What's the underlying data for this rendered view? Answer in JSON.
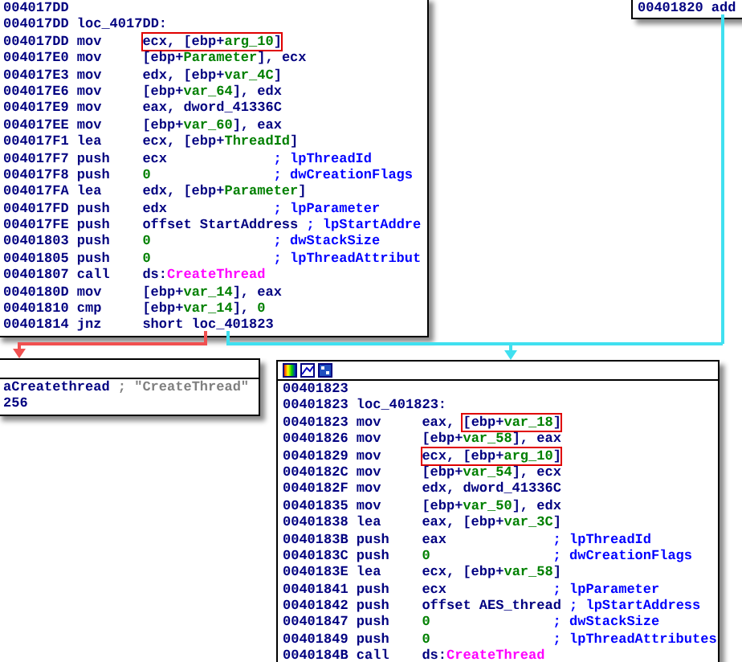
{
  "nodes": [
    {
      "kind": "plain",
      "lines": [
        {
          "address": "004017DD"
        },
        {
          "address": "004017DD",
          "label": "loc_4017DD:"
        },
        {
          "address": "004017DD",
          "mnemonic": "mov",
          "operands": [
            {
              "text": "ecx, [ebp+",
              "kind": "plain",
              "boxed": true
            },
            {
              "text": "arg_10",
              "kind": "var",
              "boxed": true
            },
            {
              "text": "]",
              "kind": "plain",
              "boxed": true
            }
          ]
        },
        {
          "address": "004017E0",
          "mnemonic": "mov",
          "operands": [
            {
              "text": "[ebp+",
              "kind": "plain",
              "boxed": false
            },
            {
              "text": "Parameter",
              "kind": "var",
              "boxed": false
            },
            {
              "text": "], ecx",
              "kind": "plain",
              "boxed": false
            }
          ]
        },
        {
          "address": "004017E3",
          "mnemonic": "mov",
          "operands": [
            {
              "text": "edx, [ebp+",
              "kind": "plain",
              "boxed": false
            },
            {
              "text": "var_4C",
              "kind": "var",
              "boxed": false
            },
            {
              "text": "]",
              "kind": "plain",
              "boxed": false
            }
          ]
        },
        {
          "address": "004017E6",
          "mnemonic": "mov",
          "operands": [
            {
              "text": "[ebp+",
              "kind": "plain",
              "boxed": false
            },
            {
              "text": "var_64",
              "kind": "var",
              "boxed": false
            },
            {
              "text": "], edx",
              "kind": "plain",
              "boxed": false
            }
          ]
        },
        {
          "address": "004017E9",
          "mnemonic": "mov",
          "operands": [
            {
              "text": "eax, dword_41336C",
              "kind": "plain",
              "boxed": false
            }
          ]
        },
        {
          "address": "004017EE",
          "mnemonic": "mov",
          "operands": [
            {
              "text": "[ebp+",
              "kind": "plain",
              "boxed": false
            },
            {
              "text": "var_60",
              "kind": "var",
              "boxed": false
            },
            {
              "text": "], eax",
              "kind": "plain",
              "boxed": false
            }
          ]
        },
        {
          "address": "004017F1",
          "mnemonic": "lea",
          "operands": [
            {
              "text": "ecx, [ebp+",
              "kind": "plain",
              "boxed": false
            },
            {
              "text": "ThreadId",
              "kind": "var",
              "boxed": false
            },
            {
              "text": "]",
              "kind": "plain",
              "boxed": false
            }
          ]
        },
        {
          "address": "004017F7",
          "mnemonic": "push",
          "operands": [
            {
              "text": "ecx",
              "kind": "plain",
              "boxed": false
            }
          ],
          "comment": {
            "text": "; lpThreadId",
            "kind": "param"
          }
        },
        {
          "address": "004017F8",
          "mnemonic": "push",
          "operands": [
            {
              "text": "0",
              "kind": "num",
              "boxed": false
            }
          ],
          "comment": {
            "text": "; dwCreationFlags",
            "kind": "param"
          }
        },
        {
          "address": "004017FA",
          "mnemonic": "lea",
          "operands": [
            {
              "text": "edx, [ebp+",
              "kind": "plain",
              "boxed": false
            },
            {
              "text": "Parameter",
              "kind": "var",
              "boxed": false
            },
            {
              "text": "]",
              "kind": "plain",
              "boxed": false
            }
          ]
        },
        {
          "address": "004017FD",
          "mnemonic": "push",
          "operands": [
            {
              "text": "edx",
              "kind": "plain",
              "boxed": false
            }
          ],
          "comment": {
            "text": "; lpParameter",
            "kind": "param"
          }
        },
        {
          "address": "004017FE",
          "mnemonic": "push",
          "operands": [
            {
              "text": "offset StartAddress",
              "kind": "plain",
              "boxed": false
            }
          ],
          "comment": {
            "text": "; lpStartAddre",
            "kind": "param"
          }
        },
        {
          "address": "00401803",
          "mnemonic": "push",
          "operands": [
            {
              "text": "0",
              "kind": "num",
              "boxed": false
            }
          ],
          "comment": {
            "text": "; dwStackSize",
            "kind": "param"
          }
        },
        {
          "address": "00401805",
          "mnemonic": "push",
          "operands": [
            {
              "text": "0",
              "kind": "num",
              "boxed": false
            }
          ],
          "comment": {
            "text": "; lpThreadAttribut",
            "kind": "param"
          }
        },
        {
          "address": "00401807",
          "mnemonic": "call",
          "operands": [
            {
              "text": "ds:",
              "kind": "plain",
              "boxed": false
            },
            {
              "text": "CreateThread",
              "kind": "import",
              "boxed": false
            }
          ]
        },
        {
          "address": "0040180D",
          "mnemonic": "mov",
          "operands": [
            {
              "text": "[ebp+",
              "kind": "plain",
              "boxed": false
            },
            {
              "text": "var_14",
              "kind": "var",
              "boxed": false
            },
            {
              "text": "], eax",
              "kind": "plain",
              "boxed": false
            }
          ]
        },
        {
          "address": "00401810",
          "mnemonic": "cmp",
          "operands": [
            {
              "text": "[ebp+",
              "kind": "plain",
              "boxed": false
            },
            {
              "text": "var_14",
              "kind": "var",
              "boxed": false
            },
            {
              "text": "], ",
              "kind": "plain",
              "boxed": false
            },
            {
              "text": "0",
              "kind": "num",
              "boxed": false
            }
          ]
        },
        {
          "address": "00401814",
          "mnemonic": "jnz",
          "operands": [
            {
              "text": "short loc_401823",
              "kind": "plain",
              "boxed": false
            }
          ]
        }
      ]
    },
    {
      "kind": "plain",
      "lines": [
        {
          "address": "00401820",
          "mnemonic": "add"
        }
      ]
    },
    {
      "kind": "titled",
      "lines": [
        {
          "operands": [
            {
              "text": "aCreatethread",
              "kind": "plain",
              "boxed": false
            }
          ],
          "comment": {
            "text": "; \"CreateThread\"",
            "kind": "string"
          }
        },
        {
          "operands": [
            {
              "text": "256",
              "kind": "plain",
              "boxed": false
            }
          ]
        }
      ]
    },
    {
      "kind": "toolbar",
      "lines": [
        {
          "address": "00401823"
        },
        {
          "address": "00401823",
          "label": "loc_401823:"
        },
        {
          "address": "00401823",
          "mnemonic": "mov",
          "operands": [
            {
              "text": "eax, ",
              "kind": "plain",
              "boxed": false
            },
            {
              "text": "[ebp+",
              "kind": "plain",
              "boxed": true
            },
            {
              "text": "var_18",
              "kind": "var",
              "boxed": true
            },
            {
              "text": "]",
              "kind": "plain",
              "boxed": true
            }
          ]
        },
        {
          "address": "00401826",
          "mnemonic": "mov",
          "operands": [
            {
              "text": "[ebp+",
              "kind": "plain",
              "boxed": false
            },
            {
              "text": "var_58",
              "kind": "var",
              "boxed": false
            },
            {
              "text": "], eax",
              "kind": "plain",
              "boxed": false
            }
          ]
        },
        {
          "address": "00401829",
          "mnemonic": "mov",
          "operands": [
            {
              "text": "ecx, [ebp+",
              "kind": "plain",
              "boxed": true
            },
            {
              "text": "arg_10",
              "kind": "var",
              "boxed": true
            },
            {
              "text": "]",
              "kind": "plain",
              "boxed": true
            }
          ]
        },
        {
          "address": "0040182C",
          "mnemonic": "mov",
          "operands": [
            {
              "text": "[ebp+",
              "kind": "plain",
              "boxed": false
            },
            {
              "text": "var_54",
              "kind": "var",
              "boxed": false
            },
            {
              "text": "], ecx",
              "kind": "plain",
              "boxed": false
            }
          ]
        },
        {
          "address": "0040182F",
          "mnemonic": "mov",
          "operands": [
            {
              "text": "edx, dword_41336C",
              "kind": "plain",
              "boxed": false
            }
          ]
        },
        {
          "address": "00401835",
          "mnemonic": "mov",
          "operands": [
            {
              "text": "[ebp+",
              "kind": "plain",
              "boxed": false
            },
            {
              "text": "var_50",
              "kind": "var",
              "boxed": false
            },
            {
              "text": "], edx",
              "kind": "plain",
              "boxed": false
            }
          ]
        },
        {
          "address": "00401838",
          "mnemonic": "lea",
          "operands": [
            {
              "text": "eax, [ebp+",
              "kind": "plain",
              "boxed": false
            },
            {
              "text": "var_3C",
              "kind": "var",
              "boxed": false
            },
            {
              "text": "]",
              "kind": "plain",
              "boxed": false
            }
          ]
        },
        {
          "address": "0040183B",
          "mnemonic": "push",
          "operands": [
            {
              "text": "eax",
              "kind": "plain",
              "boxed": false
            }
          ],
          "comment": {
            "text": "; lpThreadId",
            "kind": "param"
          }
        },
        {
          "address": "0040183C",
          "mnemonic": "push",
          "operands": [
            {
              "text": "0",
              "kind": "num",
              "boxed": false
            }
          ],
          "comment": {
            "text": "; dwCreationFlags",
            "kind": "param"
          }
        },
        {
          "address": "0040183E",
          "mnemonic": "lea",
          "operands": [
            {
              "text": "ecx, [ebp+",
              "kind": "plain",
              "boxed": false
            },
            {
              "text": "var_58",
              "kind": "var",
              "boxed": false
            },
            {
              "text": "]",
              "kind": "plain",
              "boxed": false
            }
          ]
        },
        {
          "address": "00401841",
          "mnemonic": "push",
          "operands": [
            {
              "text": "ecx",
              "kind": "plain",
              "boxed": false
            }
          ],
          "comment": {
            "text": "; lpParameter",
            "kind": "param"
          }
        },
        {
          "address": "00401842",
          "mnemonic": "push",
          "operands": [
            {
              "text": "offset AES_thread",
              "kind": "plain",
              "boxed": false
            }
          ],
          "comment": {
            "text": "; lpStartAddress",
            "kind": "param"
          }
        },
        {
          "address": "00401847",
          "mnemonic": "push",
          "operands": [
            {
              "text": "0",
              "kind": "num",
              "boxed": false
            }
          ],
          "comment": {
            "text": "; dwStackSize",
            "kind": "param"
          }
        },
        {
          "address": "00401849",
          "mnemonic": "push",
          "operands": [
            {
              "text": "0",
              "kind": "num",
              "boxed": false
            }
          ],
          "comment": {
            "text": "; lpThreadAttributes",
            "kind": "param"
          }
        },
        {
          "address": "0040184B",
          "mnemonic": "call",
          "operands": [
            {
              "text": "ds:",
              "kind": "plain",
              "boxed": false
            },
            {
              "text": "CreateThread",
              "kind": "import",
              "boxed": false
            }
          ]
        }
      ]
    }
  ],
  "edges": [
    {
      "kind": "branch",
      "color": "#f05050"
    },
    {
      "kind": "jump",
      "color": "#40e0f0"
    }
  ]
}
